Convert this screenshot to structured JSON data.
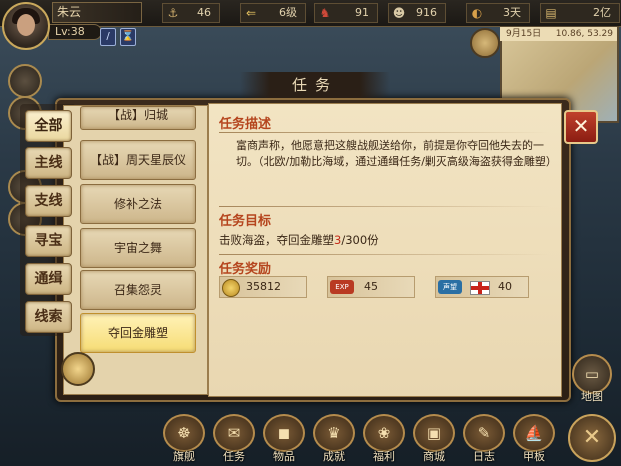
{
  "player": {
    "name": "朱云",
    "level": "Lv:38"
  },
  "topbar": {
    "stats": [
      {
        "icon": "anchor-icon",
        "glyph": "⚓",
        "value": "46"
      },
      {
        "icon": "arrows-icon",
        "glyph": "⇐",
        "value": "6级"
      },
      {
        "icon": "crew-icon",
        "glyph": "♞",
        "value": "91"
      },
      {
        "icon": "sailor-icon",
        "glyph": "☻",
        "value": "916"
      },
      {
        "icon": "bread-icon",
        "glyph": "◐",
        "value": "3天"
      },
      {
        "icon": "money-icon",
        "glyph": "▤",
        "value": "2亿"
      }
    ]
  },
  "minimap": {
    "date": "9月15日",
    "coords": "10.86, 53.29"
  },
  "panel": {
    "title": "任务"
  },
  "categories": [
    "全部",
    "主线",
    "支线",
    "寻宝",
    "通缉",
    "线索"
  ],
  "quests": [
    "【战】归城",
    "【战】周天星辰仪",
    "修补之法",
    "宇宙之舞",
    "召集怨灵",
    "夺回金雕塑"
  ],
  "detail": {
    "desc_title": "任务描述",
    "desc_text": "富商声称，他愿意把这艘战舰送给你，前提是你夺回他失去的一切。（北欧/加勒比海域，通过通缉任务/剿灭高级海盗获得金雕塑）",
    "goal_title": "任务目标",
    "goal_prefix": "击败海盗，夺回金雕塑",
    "goal_count": "3",
    "goal_total": "/300份",
    "reward_title": "任务奖励",
    "rewards": [
      {
        "icon": "coin-icon",
        "value": "35812"
      },
      {
        "icon": "exp-badge-icon",
        "tag": "EXP",
        "value": "45"
      },
      {
        "icon": "reputation-badge-icon",
        "tag": "声望",
        "value": "40"
      }
    ]
  },
  "close_glyph": "✕",
  "map_button": {
    "label": "地图"
  },
  "bottom_nav": [
    {
      "label": "旗舰",
      "glyph": "☸"
    },
    {
      "label": "任务",
      "glyph": "✉"
    },
    {
      "label": "物品",
      "glyph": "◼"
    },
    {
      "label": "成就",
      "glyph": "♛"
    },
    {
      "label": "福利",
      "glyph": "❀"
    },
    {
      "label": "商城",
      "glyph": "▣"
    },
    {
      "label": "日志",
      "glyph": "✎"
    },
    {
      "label": "甲板",
      "glyph": "⛵"
    }
  ]
}
